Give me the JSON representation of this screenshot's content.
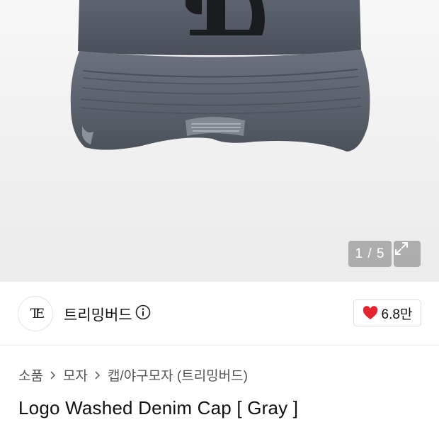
{
  "gallery": {
    "pager_text": "1 / 5",
    "image_alt": "Gray washed denim cap with embroidered logo"
  },
  "brand": {
    "logo_text": "TE",
    "name": "트리밍버드"
  },
  "like": {
    "count": "6.8만",
    "heart_color": "#e5242f"
  },
  "breadcrumb": {
    "items": [
      "소품",
      "모자",
      "캡/야구모자 (트리밍버드)"
    ]
  },
  "product": {
    "title": "Logo Washed Denim Cap [ Gray ]"
  }
}
